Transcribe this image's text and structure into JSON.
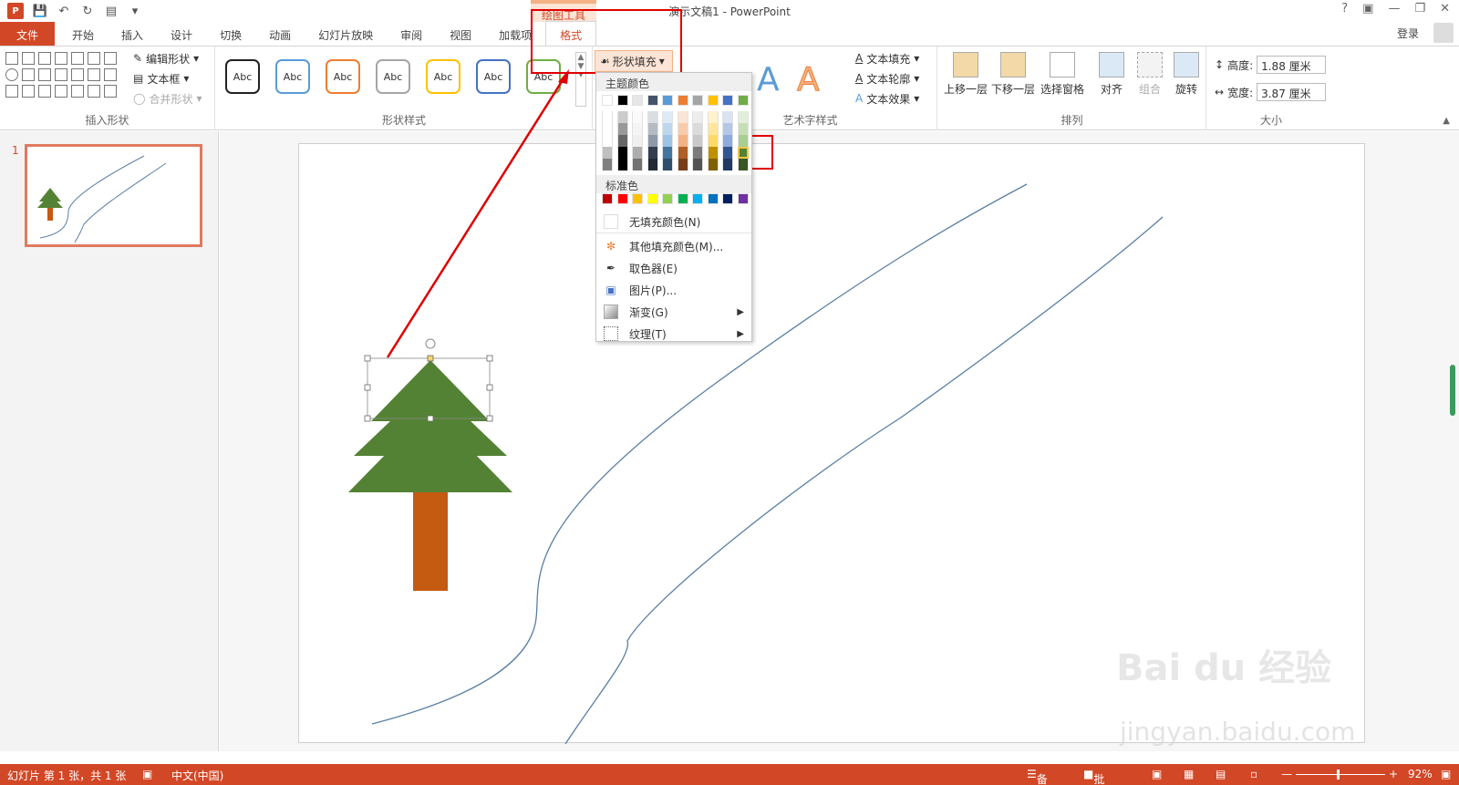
{
  "window": {
    "title": "演示文稿1 - PowerPoint",
    "help": "?",
    "drawing_tools": "绘图工具"
  },
  "tabs": [
    "开始",
    "插入",
    "设计",
    "切换",
    "动画",
    "幻灯片放映",
    "审阅",
    "视图",
    "加载项",
    "格式"
  ],
  "file_tab": "文件",
  "account": {
    "login": "登录"
  },
  "ribbon": {
    "insert_shapes": {
      "edit_shape": "编辑形状",
      "text_box": "文本框",
      "merge_shapes": "合并形状",
      "label": "插入形状"
    },
    "shape_styles": {
      "sample": "Abc",
      "label": "形状样式",
      "fill_button": "形状填充"
    },
    "wordart": {
      "text_fill": "文本填充",
      "text_outline": "文本轮廓",
      "text_effects": "文本效果",
      "label": "艺术字样式"
    },
    "arrange": {
      "bring_forward": "上移一层",
      "send_backward": "下移一层",
      "selection_pane": "选择窗格",
      "align": "对齐",
      "group": "组合",
      "rotate": "旋转",
      "label": "排列"
    },
    "size": {
      "height_label": "高度:",
      "height_value": "1.88 厘米",
      "width_label": "宽度:",
      "width_value": "3.87 厘米",
      "label": "大小"
    }
  },
  "dropdown": {
    "theme_colors": "主题颜色",
    "standard_colors": "标准色",
    "no_fill": "无填充颜色(N)",
    "more_colors": "其他填充颜色(M)...",
    "eyedropper": "取色器(E)",
    "picture": "图片(P)...",
    "gradient": "渐变(G)",
    "texture": "纹理(T)",
    "theme_top_row": [
      "#ffffff",
      "#000000",
      "#e7e6e6",
      "#44546a",
      "#5b9bd5",
      "#ed7d31",
      "#a5a5a5",
      "#ffc000",
      "#4472c4",
      "#70ad47"
    ],
    "standard_row": [
      "#c00000",
      "#ff0000",
      "#ffc000",
      "#ffff00",
      "#92d050",
      "#00b050",
      "#00b0f0",
      "#0070c0",
      "#002060",
      "#7030a0"
    ],
    "selected_color": "#548235"
  },
  "slide_pane": {
    "slide_number": "1"
  },
  "status": {
    "slide_info": "幻灯片 第 1 张，共 1 张",
    "language": "中文(中国)",
    "notes": "备注",
    "comments": "批注",
    "zoom": "92%"
  },
  "colors": {
    "accent": "#d24726",
    "tree_green": "#548235",
    "trunk": "#c55a11",
    "road": "#5b7fa3",
    "highlight_red": "#e00000"
  },
  "watermark": {
    "brand": "Bai du 经验",
    "url": "jingyan.baidu.com"
  }
}
